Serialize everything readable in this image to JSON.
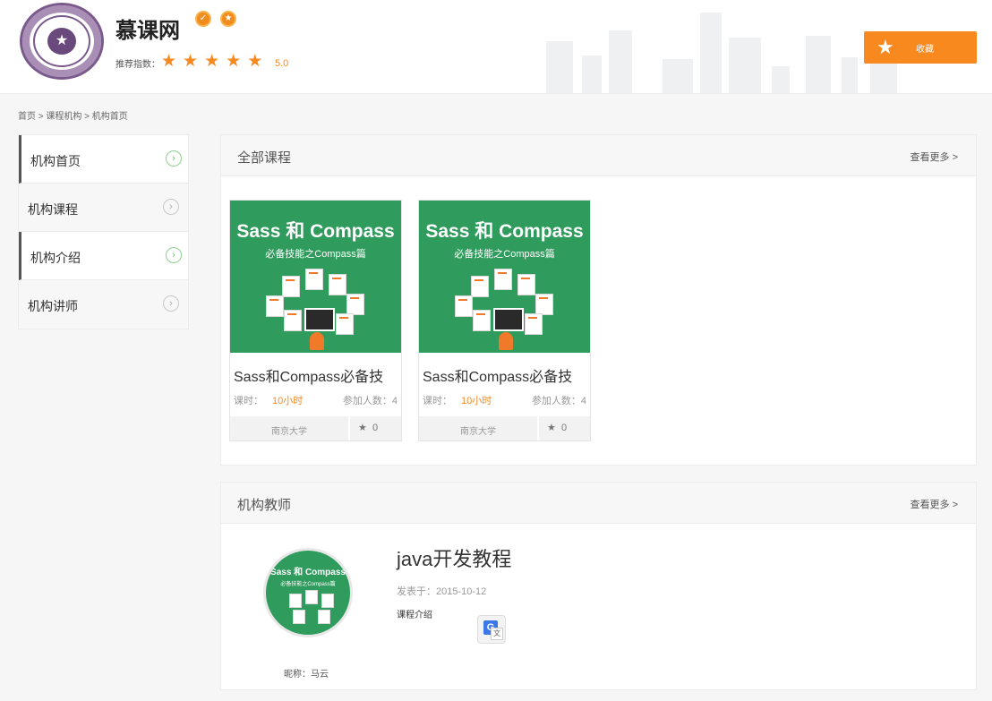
{
  "header": {
    "brand_name": "慕课网",
    "logo_text": "SIGNUM",
    "rating_label": "推荐指数：",
    "rating_value": "5.0",
    "rating_stars": 5,
    "favorite_label": "收藏"
  },
  "breadcrumb": "首页 > 课程机构 > 机构首页",
  "sidebar": {
    "items": [
      {
        "label": "机构首页"
      },
      {
        "label": "机构课程"
      },
      {
        "label": "机构介绍"
      },
      {
        "label": "机构讲师"
      }
    ]
  },
  "courses_panel": {
    "title": "全部课程",
    "more": "查看更多 >",
    "cards": [
      {
        "thumb_title": "Sass 和 Compass",
        "thumb_subtitle": "必备技能之Compass篇",
        "title": "Sass和Compass必备技",
        "hours_label": "课时：",
        "hours_value": "10小时",
        "learners": "参加人数：4",
        "school": "南京大学",
        "favorites": "0"
      },
      {
        "thumb_title": "Sass 和 Compass",
        "thumb_subtitle": "必备技能之Compass篇",
        "title": "Sass和Compass必备技",
        "hours_label": "课时：",
        "hours_value": "10小时",
        "learners": "参加人数：4",
        "school": "南京大学",
        "favorites": "0"
      }
    ]
  },
  "teachers_panel": {
    "title": "机构教师",
    "more": "查看更多 >",
    "avatar_title": "Sass 和 Compass",
    "avatar_subtitle": "必备技能之Compass篇",
    "nickname": "昵称：马云",
    "course_name": "java开发教程",
    "published": "发表于：2015-10-12",
    "intro_label": "课程介绍"
  },
  "colors": {
    "accent": "#f7891f",
    "course_green": "#2f9b5c"
  }
}
